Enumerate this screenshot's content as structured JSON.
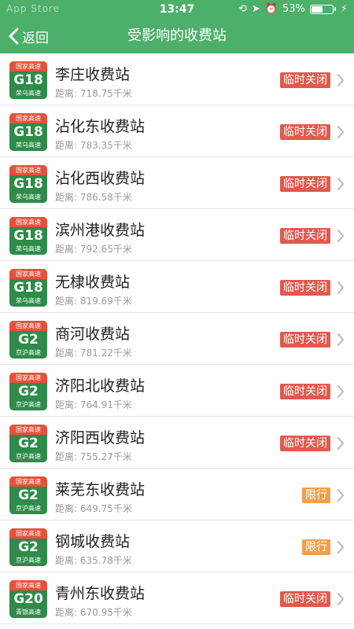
{
  "status": {
    "carrier": "App Store",
    "time": "13:47",
    "battery": "53%",
    "battery_level": 0.53
  },
  "nav": {
    "back_label": "返回",
    "title": "受影响的收费站"
  },
  "colors": {
    "primary": "#4caf6a",
    "shield_green": "#2e8b4a",
    "shield_red": "#e8503a",
    "badge_closed": "#e05a4e",
    "badge_limit": "#f0a04a"
  },
  "stations": [
    {
      "shield_top": "国家高速",
      "shield_code": "G18",
      "shield_sub": "荣乌高速",
      "name": "李庄收费站",
      "distance": "距离: 718.75千米",
      "status": "临时关闭",
      "status_type": "closed"
    },
    {
      "shield_top": "国家高速",
      "shield_code": "G18",
      "shield_sub": "荣乌高速",
      "name": "沾化东收费站",
      "distance": "距离: 783.35千米",
      "status": "临时关闭",
      "status_type": "closed"
    },
    {
      "shield_top": "国家高速",
      "shield_code": "G18",
      "shield_sub": "荣乌高速",
      "name": "沾化西收费站",
      "distance": "距离: 786.58千米",
      "status": "临时关闭",
      "status_type": "closed"
    },
    {
      "shield_top": "国家高速",
      "shield_code": "G18",
      "shield_sub": "荣乌高速",
      "name": "滨州港收费站",
      "distance": "距离: 792.65千米",
      "status": "临时关闭",
      "status_type": "closed"
    },
    {
      "shield_top": "国家高速",
      "shield_code": "G18",
      "shield_sub": "荣乌高速",
      "name": "无棣收费站",
      "distance": "距离: 819.69千米",
      "status": "临时关闭",
      "status_type": "closed"
    },
    {
      "shield_top": "国家高速",
      "shield_code": "G2",
      "shield_sub": "京沪高速",
      "name": "商河收费站",
      "distance": "距离: 781.22千米",
      "status": "临时关闭",
      "status_type": "closed"
    },
    {
      "shield_top": "国家高速",
      "shield_code": "G2",
      "shield_sub": "京沪高速",
      "name": "济阳北收费站",
      "distance": "距离: 764.91千米",
      "status": "临时关闭",
      "status_type": "closed"
    },
    {
      "shield_top": "国家高速",
      "shield_code": "G2",
      "shield_sub": "京沪高速",
      "name": "济阳西收费站",
      "distance": "距离: 755.27千米",
      "status": "临时关闭",
      "status_type": "closed"
    },
    {
      "shield_top": "国家高速",
      "shield_code": "G2",
      "shield_sub": "京沪高速",
      "name": "莱芜东收费站",
      "distance": "距离: 649.75千米",
      "status": "限行",
      "status_type": "limit"
    },
    {
      "shield_top": "国家高速",
      "shield_code": "G2",
      "shield_sub": "京沪高速",
      "name": "钢城收费站",
      "distance": "距离: 635.78千米",
      "status": "限行",
      "status_type": "limit"
    },
    {
      "shield_top": "国家高速",
      "shield_code": "G20",
      "shield_sub": "青银高速",
      "name": "青州东收费站",
      "distance": "距离: 670.95千米",
      "status": "临时关闭",
      "status_type": "closed"
    }
  ]
}
